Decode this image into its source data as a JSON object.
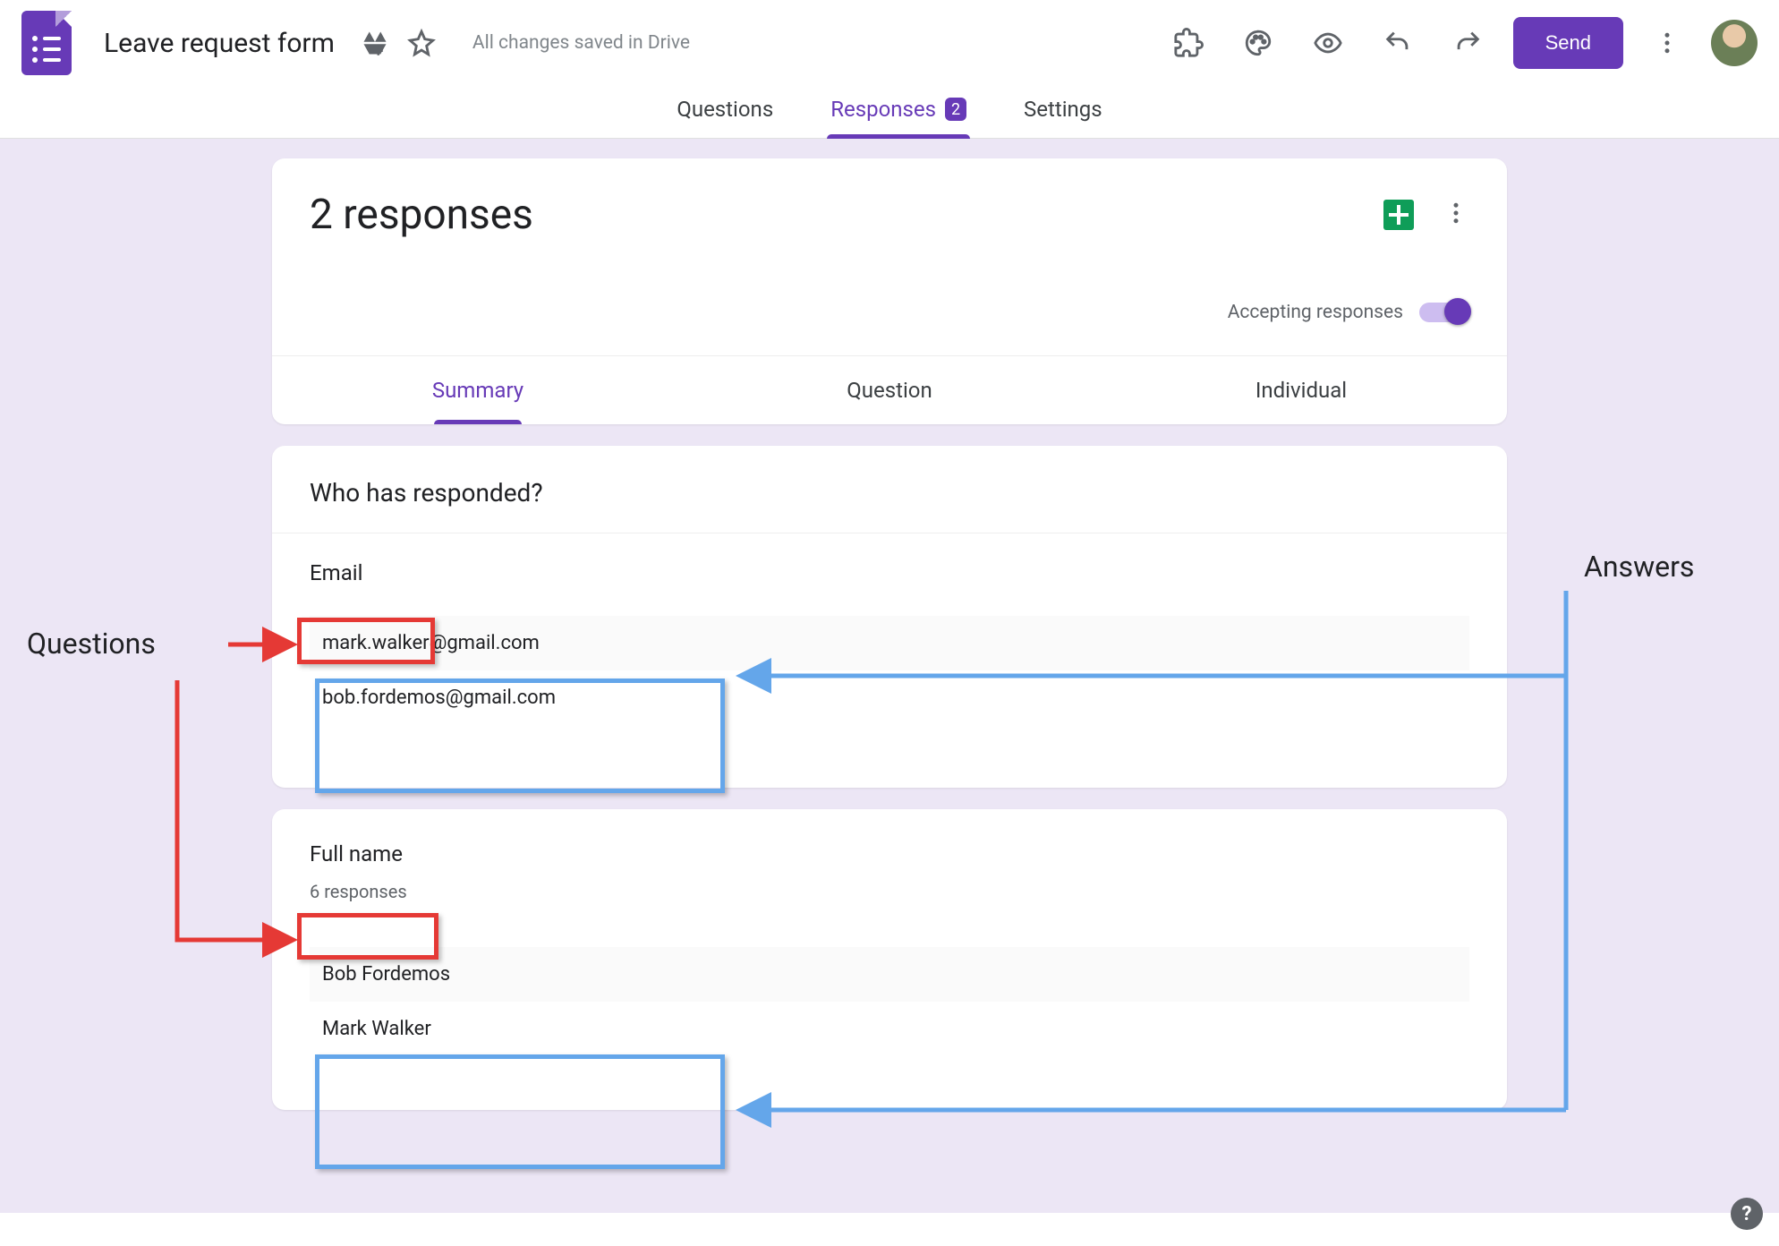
{
  "header": {
    "doc_title": "Leave request form",
    "saved_status": "All changes saved in Drive",
    "send_label": "Send"
  },
  "top_tabs": {
    "questions": "Questions",
    "responses": "Responses",
    "responses_badge": "2",
    "settings": "Settings"
  },
  "responses": {
    "heading": "2 responses",
    "accepting_label": "Accepting responses",
    "accepting_on": true,
    "sub_tabs": {
      "summary": "Summary",
      "question": "Question",
      "individual": "Individual"
    },
    "responded_title": "Who has responded?",
    "sections": [
      {
        "label": "Email",
        "count_text": null,
        "answers": [
          "mark.walker@gmail.com",
          "bob.fordemos@gmail.com"
        ]
      },
      {
        "label": "Full name",
        "count_text": "6 responses",
        "answers": [
          "Bob Fordemos",
          "Mark Walker"
        ]
      }
    ]
  },
  "annotations": {
    "questions_label": "Questions",
    "answers_label": "Answers"
  }
}
